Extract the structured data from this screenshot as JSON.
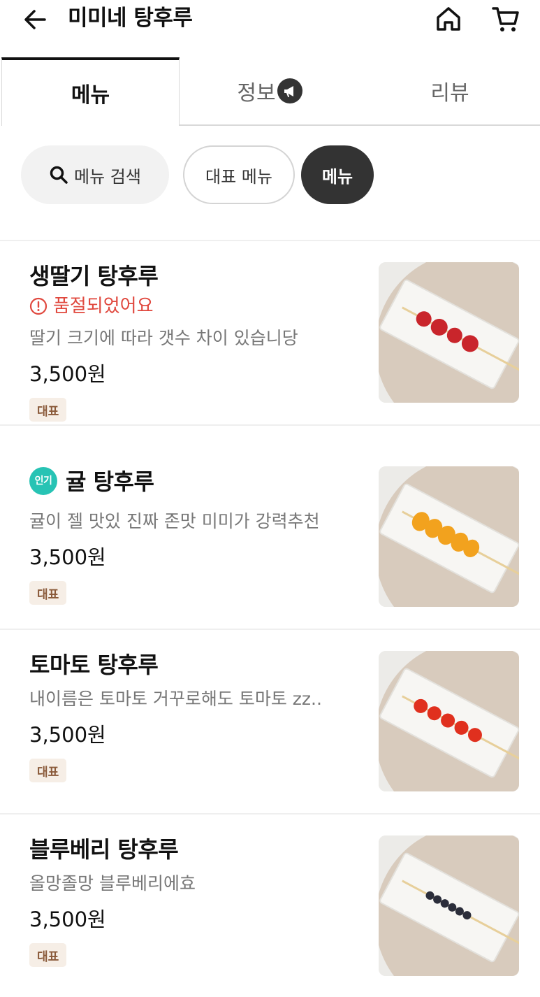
{
  "header": {
    "title": "미미네 탕후루"
  },
  "tabs": [
    {
      "label": "메뉴"
    },
    {
      "label": "정보"
    },
    {
      "label": "리뷰"
    }
  ],
  "chips": {
    "search": "메뉴 검색",
    "representative": "대표 메뉴",
    "menu": "메뉴"
  },
  "items": [
    {
      "name": "생딸기 탕후루",
      "status": "품절되었어요",
      "desc": "딸기 크기에 따라 갯수 차이 있습니당",
      "price": "3,500원",
      "tag": "대표",
      "fruit_color": "#c9252b"
    },
    {
      "name": "귤 탕후루",
      "badge": "인기",
      "desc": "귤이 젤 맛있 진짜 존맛 미미가 강력추천",
      "price": "3,500원",
      "tag": "대표",
      "fruit_color": "#f2a21e"
    },
    {
      "name": "토마토 탕후루",
      "desc": "내이름은 토마토 거꾸로해도 토마토 zz..",
      "price": "3,500원",
      "tag": "대표",
      "fruit_color": "#e0301e"
    },
    {
      "name": "블루베리 탕후루",
      "desc": "올망졸망 블루베리에효",
      "price": "3,500원",
      "tag": "대표",
      "fruit_color": "#2b2d3a"
    }
  ],
  "colors": {
    "soldout": "#e0483e",
    "popular_badge": "#27c3b4",
    "tag_bg": "#f6eee6",
    "tag_text": "#8a5a3a"
  }
}
